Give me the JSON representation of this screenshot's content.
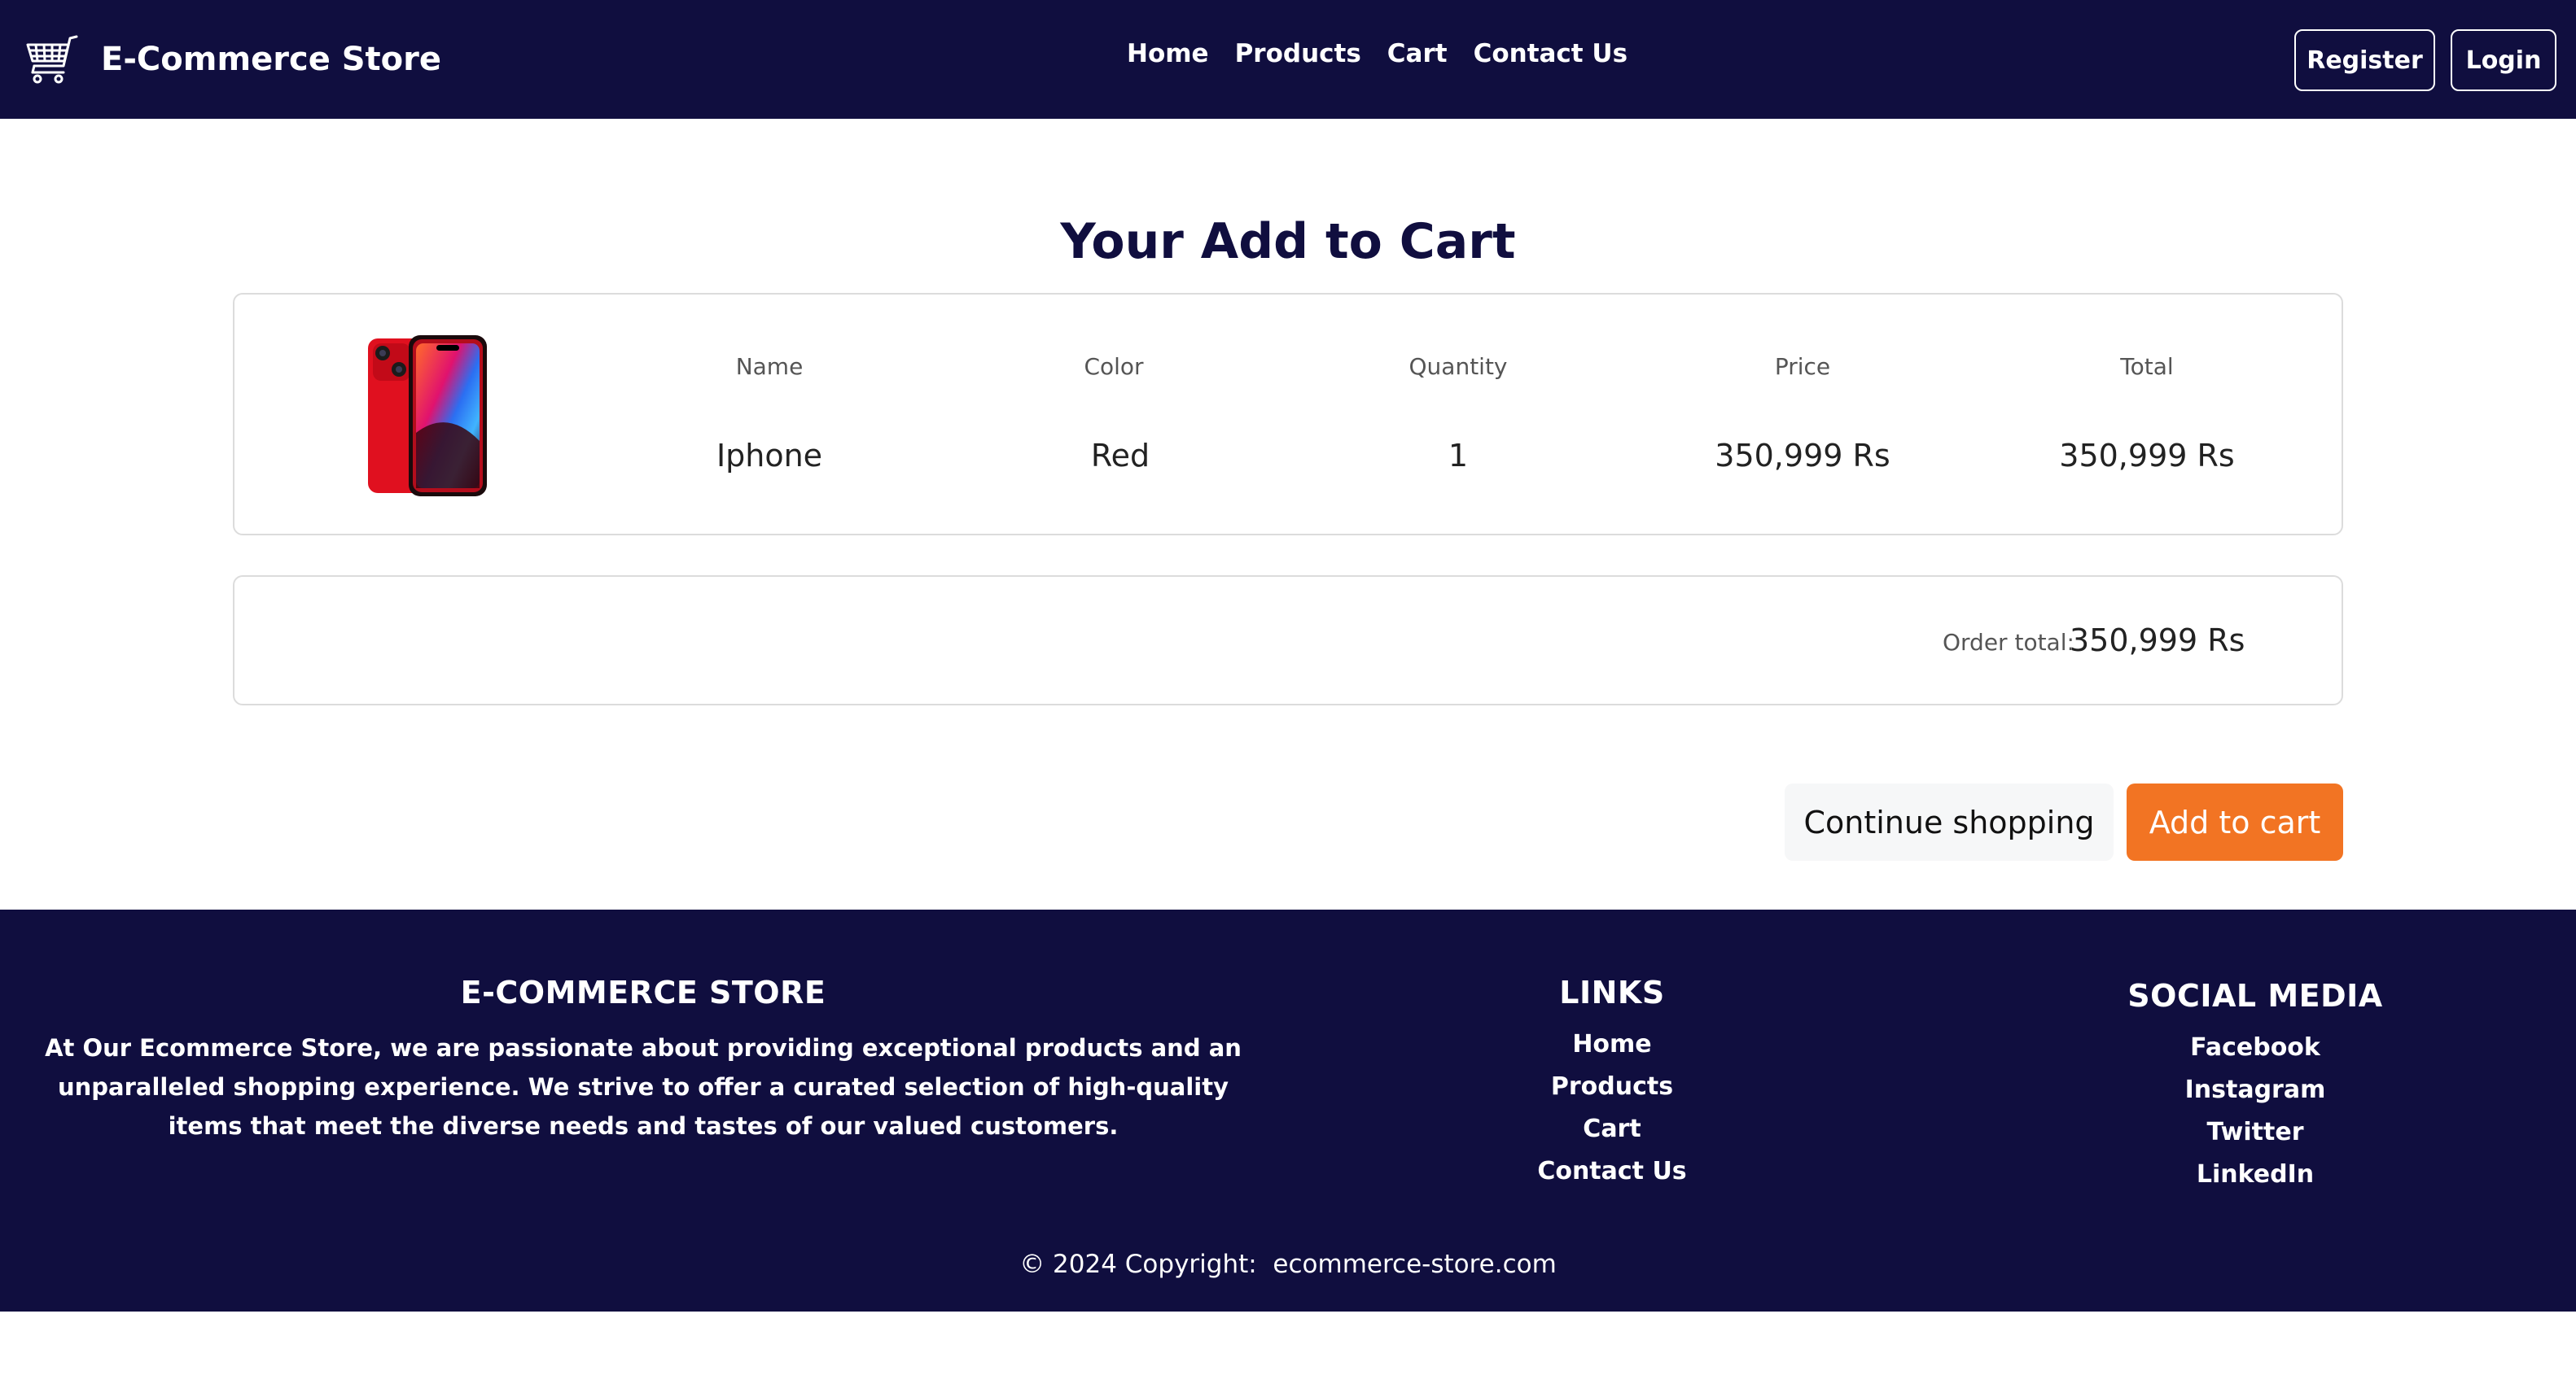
{
  "navbar": {
    "brand_name": "E-Commerce Store",
    "links": [
      "Home",
      "Products",
      "Cart",
      "Contact Us"
    ],
    "register_label": "Register",
    "login_label": "Login"
  },
  "main": {
    "title": "Your Add to Cart",
    "cart_item": {
      "headers": {
        "name": "Name",
        "color": "Color",
        "quantity": "Quantity",
        "price": "Price",
        "total": "Total"
      },
      "values": {
        "name": "Iphone",
        "color": "Red",
        "quantity": "1",
        "price": "350,999 Rs",
        "total": "350,999 Rs"
      },
      "product_image_color": "#e0101f"
    },
    "order_total": {
      "label": "Order total:",
      "value": "350,999 Rs"
    },
    "continue_label": "Continue shopping",
    "add_to_cart_label": "Add to cart"
  },
  "footer": {
    "about": {
      "heading": "E-COMMERCE STORE",
      "text": "At Our Ecommerce Store, we are passionate about providing exceptional products and an unparalleled shopping experience. We strive to offer a curated selection of high-quality items that meet the diverse needs and tastes of our valued customers."
    },
    "links": {
      "heading": "LINKS",
      "items": [
        "Home",
        "Products",
        "Cart",
        "Contact Us"
      ]
    },
    "social": {
      "heading": "SOCIAL MEDIA",
      "items": [
        "Facebook",
        "Instagram",
        "Twitter",
        "LinkedIn"
      ]
    },
    "copyright": "© 2024 Copyright:  ecommerce-store.com"
  },
  "colors": {
    "navy": "#100e3f",
    "accent_orange": "#f27423",
    "card_border": "#dcdcdc"
  }
}
